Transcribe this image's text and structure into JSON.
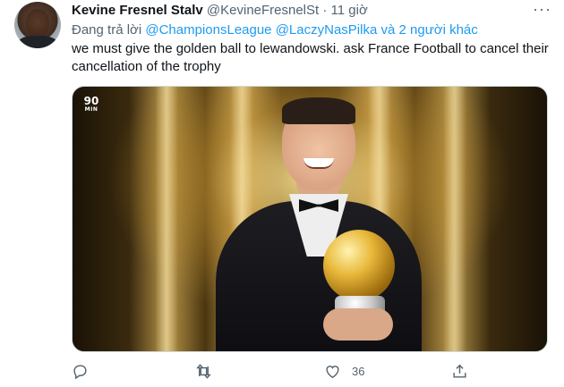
{
  "tweet": {
    "author_name": "Kevine Fresnel Stalv",
    "author_handle": "@KevineFresnelSt",
    "separator": "·",
    "time": "11 giờ",
    "more_label": "···",
    "replying_prefix": "Đang trả lời",
    "replying_to_1": "@ChampionsLeague",
    "replying_to_2": "@LaczyNasPilka",
    "replying_suffix": "và 2 người khác",
    "text": "we must give the golden ball to lewandowski. ask France Football to cancel their cancellation of the trophy",
    "media_logo": "90",
    "media_logo_sub": "MIN"
  },
  "actions": {
    "reply_count": "",
    "retweet_count": "",
    "like_count": "36",
    "share_count": ""
  },
  "colors": {
    "link": "#1d9bf0",
    "secondary_text": "#536471",
    "primary_text": "#0f1419"
  },
  "icons": [
    "more-icon",
    "reply-icon",
    "retweet-icon",
    "like-icon",
    "share-icon"
  ]
}
